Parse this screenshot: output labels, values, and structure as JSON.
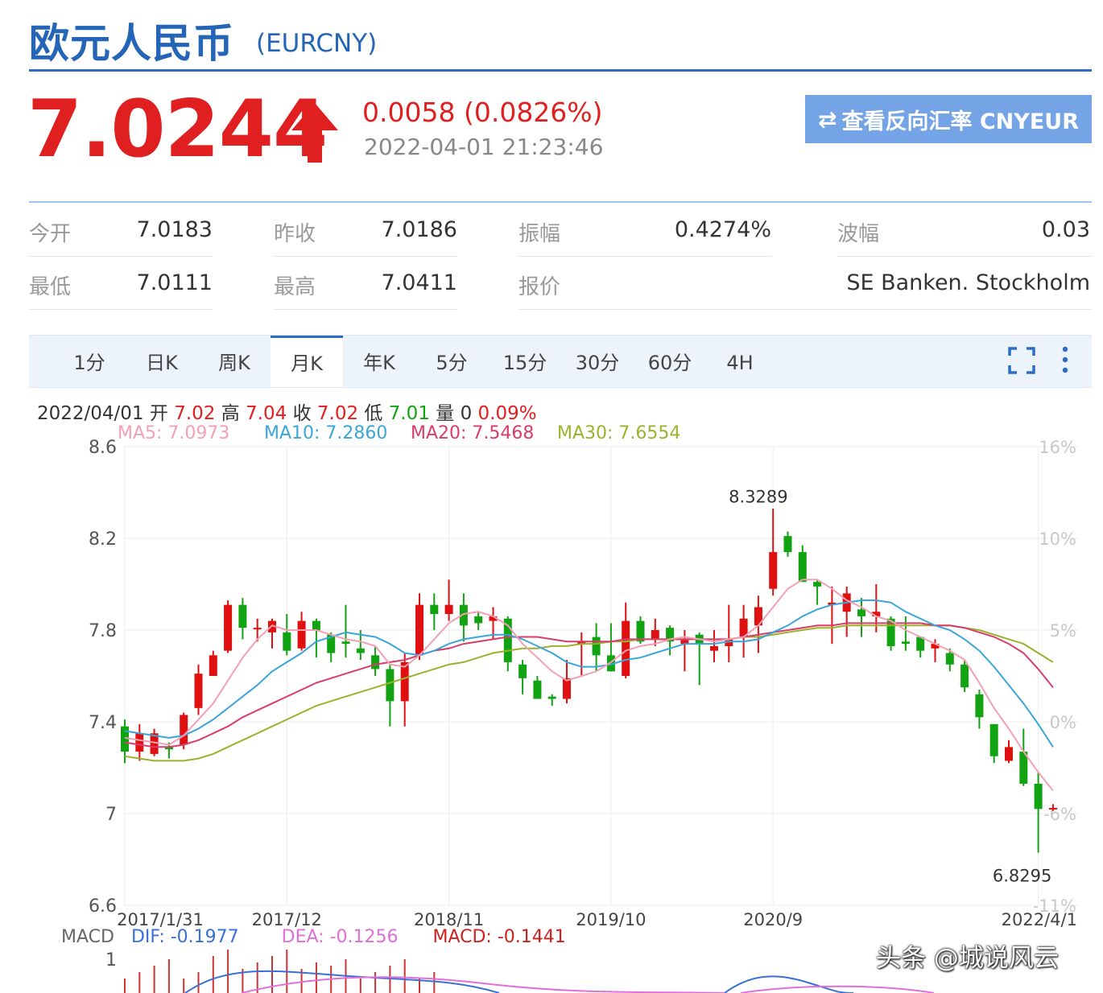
{
  "header": {
    "title": "欧元人民币",
    "code": "(EURCNY)",
    "price": "7.0244",
    "change": "0.0058 (0.0826%)",
    "time": "2022-04-01 21:23:46",
    "reverse_button": "查看反向汇率 CNYEUR",
    "price_color": "#e02020",
    "brand_color": "#2465b8"
  },
  "stats": [
    {
      "label": "今开",
      "value": "7.0183"
    },
    {
      "label": "昨收",
      "value": "7.0186"
    },
    {
      "label": "振幅",
      "value": "0.4274%"
    },
    {
      "label": "波幅",
      "value": "0.03"
    },
    {
      "label": "最低",
      "value": "7.0111"
    },
    {
      "label": "最高",
      "value": "7.0411"
    },
    {
      "label": "报价",
      "value": "SE Banken. Stockholm"
    }
  ],
  "tabs": [
    "1分",
    "日K",
    "周K",
    "月K",
    "年K",
    "5分",
    "15分",
    "30分",
    "60分",
    "4H"
  ],
  "active_tab": "月K",
  "toolbar_icons": [
    "fullscreen-icon",
    "more-vertical-icon"
  ],
  "info_line": {
    "date": "2022/04/01",
    "open_label": "开",
    "open": "7.02",
    "high_label": "高",
    "high": "7.04",
    "close_label": "收",
    "close": "7.02",
    "low_label": "低",
    "low": "7.01",
    "vol_label": "量",
    "vol": "0",
    "pct": "0.09%"
  },
  "ma_legend": [
    {
      "text": "MA5: 7.0973",
      "color": "#f2a0b4"
    },
    {
      "text": "MA10: 7.2860",
      "color": "#3aa6d8"
    },
    {
      "text": "MA20: 7.5468",
      "color": "#d83c6a"
    },
    {
      "text": "MA30: 7.6554",
      "color": "#9cb22c"
    }
  ],
  "macd_legend": {
    "label": "MACD",
    "dif": "DIF: -0.1977",
    "dea": "DEA: -0.1256",
    "macd": "MACD: -0.1441"
  },
  "watermark": "头条 @城说风云",
  "chart_data": {
    "type": "candlestick",
    "interval": "monthly",
    "ylim": [
      6.6,
      8.6
    ],
    "y_ticks": [
      "8.6",
      "8.2",
      "7.8",
      "7.4",
      "7",
      "6.6"
    ],
    "y_tick_values": [
      8.6,
      8.2,
      7.8,
      7.4,
      7.0,
      6.6
    ],
    "right_ticks": [
      "16%",
      "10%",
      "5%",
      "0%",
      "-6%",
      "-11%"
    ],
    "x_ticks": [
      "2017/1/31",
      "2017/12",
      "2018/11",
      "2019/10",
      "2020/9",
      "2022/4/1"
    ],
    "x_tick_index": [
      0,
      11,
      22,
      33,
      44,
      62
    ],
    "annotations": [
      {
        "text": "8.3289",
        "index": 43,
        "value": 8.3289
      },
      {
        "text": "6.8295",
        "index": 62,
        "value": 6.8295
      }
    ],
    "up_color": "#e01010",
    "down_color": "#12a312",
    "candles": [
      [
        7.38,
        7.27,
        7.41,
        7.22
      ],
      [
        7.27,
        7.35,
        7.39,
        7.23
      ],
      [
        7.26,
        7.35,
        7.37,
        7.25
      ],
      [
        7.29,
        7.28,
        7.31,
        7.24
      ],
      [
        7.3,
        7.43,
        7.44,
        7.28
      ],
      [
        7.46,
        7.61,
        7.65,
        7.43
      ],
      [
        7.6,
        7.69,
        7.71,
        7.6
      ],
      [
        7.71,
        7.91,
        7.93,
        7.7
      ],
      [
        7.91,
        7.81,
        7.94,
        7.76
      ],
      [
        7.81,
        7.81,
        7.85,
        7.75
      ],
      [
        7.79,
        7.84,
        7.85,
        7.72
      ],
      [
        7.79,
        7.71,
        7.87,
        7.69
      ],
      [
        7.72,
        7.84,
        7.88,
        7.71
      ],
      [
        7.84,
        7.8,
        7.85,
        7.68
      ],
      [
        7.78,
        7.7,
        7.79,
        7.66
      ],
      [
        7.75,
        7.74,
        7.91,
        7.68
      ],
      [
        7.72,
        7.7,
        7.8,
        7.67
      ],
      [
        7.69,
        7.63,
        7.73,
        7.6
      ],
      [
        7.63,
        7.49,
        7.65,
        7.38
      ],
      [
        7.49,
        7.66,
        7.7,
        7.38
      ],
      [
        7.69,
        7.91,
        7.96,
        7.67
      ],
      [
        7.91,
        7.87,
        7.96,
        7.8
      ],
      [
        7.87,
        7.91,
        8.02,
        7.84
      ],
      [
        7.91,
        7.82,
        7.96,
        7.75
      ],
      [
        7.86,
        7.83,
        7.88,
        7.8
      ],
      [
        7.84,
        7.86,
        7.9,
        7.76
      ],
      [
        7.85,
        7.66,
        7.86,
        7.62
      ],
      [
        7.65,
        7.59,
        7.67,
        7.52
      ],
      [
        7.58,
        7.5,
        7.6,
        7.5
      ],
      [
        7.51,
        7.5,
        7.52,
        7.47
      ],
      [
        7.5,
        7.59,
        7.67,
        7.48
      ],
      [
        7.74,
        7.75,
        7.79,
        7.6
      ],
      [
        7.77,
        7.69,
        7.83,
        7.62
      ],
      [
        7.69,
        7.62,
        7.83,
        7.62
      ],
      [
        7.6,
        7.84,
        7.92,
        7.59
      ],
      [
        7.84,
        7.75,
        7.86,
        7.74
      ],
      [
        7.76,
        7.8,
        7.85,
        7.73
      ],
      [
        7.81,
        7.75,
        7.82,
        7.69
      ],
      [
        7.74,
        7.76,
        7.8,
        7.62
      ],
      [
        7.78,
        7.74,
        7.79,
        7.56
      ],
      [
        7.71,
        7.73,
        7.8,
        7.66
      ],
      [
        7.73,
        7.76,
        7.91,
        7.66
      ],
      [
        7.77,
        7.85,
        7.91,
        7.68
      ],
      [
        7.82,
        7.9,
        7.95,
        7.7
      ],
      [
        7.98,
        8.14,
        8.33,
        7.95
      ],
      [
        8.21,
        8.14,
        8.23,
        8.12
      ],
      [
        8.14,
        8.01,
        8.17,
        8.01
      ],
      [
        8.01,
        7.99,
        8.02,
        7.91
      ],
      [
        7.91,
        7.92,
        7.99,
        7.74
      ],
      [
        7.88,
        7.96,
        7.99,
        7.77
      ],
      [
        7.89,
        7.86,
        7.94,
        7.77
      ],
      [
        7.86,
        7.88,
        8.0,
        7.79
      ],
      [
        7.85,
        7.73,
        7.86,
        7.71
      ],
      [
        7.75,
        7.74,
        7.86,
        7.71
      ],
      [
        7.77,
        7.71,
        7.77,
        7.68
      ],
      [
        7.72,
        7.74,
        7.76,
        7.66
      ],
      [
        7.7,
        7.65,
        7.72,
        7.62
      ],
      [
        7.65,
        7.55,
        7.67,
        7.53
      ],
      [
        7.52,
        7.42,
        7.54,
        7.37
      ],
      [
        7.39,
        7.25,
        7.39,
        7.22
      ],
      [
        7.23,
        7.29,
        7.32,
        7.22
      ],
      [
        7.27,
        7.13,
        7.37,
        7.12
      ],
      [
        7.13,
        7.02,
        7.18,
        6.83
      ],
      [
        7.0183,
        7.0244,
        7.0411,
        7.0111
      ]
    ],
    "ma5": [
      7.33,
      7.32,
      7.31,
      7.3,
      7.34,
      7.41,
      7.48,
      7.58,
      7.68,
      7.76,
      7.82,
      7.8,
      7.8,
      7.8,
      7.78,
      7.76,
      7.75,
      7.73,
      7.65,
      7.64,
      7.69,
      7.76,
      7.83,
      7.87,
      7.88,
      7.86,
      7.82,
      7.74,
      7.68,
      7.62,
      7.58,
      7.6,
      7.62,
      7.66,
      7.71,
      7.73,
      7.74,
      7.76,
      7.77,
      7.76,
      7.75,
      7.76,
      7.77,
      7.82,
      7.9,
      7.98,
      8.02,
      8.02,
      7.98,
      7.93,
      7.9,
      7.86,
      7.84,
      7.8,
      7.77,
      7.74,
      7.71,
      7.67,
      7.57,
      7.46,
      7.37,
      7.27,
      7.18,
      7.1
    ],
    "ma10": [
      7.36,
      7.35,
      7.34,
      7.33,
      7.34,
      7.37,
      7.41,
      7.46,
      7.51,
      7.56,
      7.62,
      7.66,
      7.7,
      7.75,
      7.77,
      7.79,
      7.78,
      7.77,
      7.74,
      7.7,
      7.69,
      7.71,
      7.74,
      7.76,
      7.77,
      7.78,
      7.78,
      7.76,
      7.73,
      7.7,
      7.66,
      7.64,
      7.64,
      7.65,
      7.67,
      7.68,
      7.7,
      7.72,
      7.74,
      7.74,
      7.74,
      7.75,
      7.75,
      7.76,
      7.79,
      7.82,
      7.86,
      7.89,
      7.91,
      7.92,
      7.93,
      7.93,
      7.92,
      7.88,
      7.85,
      7.82,
      7.8,
      7.76,
      7.71,
      7.64,
      7.56,
      7.48,
      7.39,
      7.29
    ],
    "ma20": [
      7.31,
      7.3,
      7.29,
      7.29,
      7.3,
      7.32,
      7.35,
      7.38,
      7.42,
      7.45,
      7.48,
      7.51,
      7.54,
      7.57,
      7.59,
      7.61,
      7.63,
      7.65,
      7.66,
      7.67,
      7.69,
      7.71,
      7.72,
      7.74,
      7.75,
      7.76,
      7.77,
      7.77,
      7.77,
      7.76,
      7.75,
      7.75,
      7.75,
      7.75,
      7.76,
      7.76,
      7.76,
      7.76,
      7.76,
      7.76,
      7.76,
      7.76,
      7.77,
      7.78,
      7.79,
      7.8,
      7.81,
      7.82,
      7.82,
      7.83,
      7.83,
      7.83,
      7.83,
      7.83,
      7.83,
      7.82,
      7.82,
      7.81,
      7.79,
      7.77,
      7.74,
      7.7,
      7.63,
      7.55
    ],
    "ma30": [
      7.25,
      7.24,
      7.23,
      7.23,
      7.23,
      7.24,
      7.26,
      7.29,
      7.32,
      7.35,
      7.38,
      7.41,
      7.44,
      7.47,
      7.49,
      7.51,
      7.53,
      7.55,
      7.57,
      7.59,
      7.61,
      7.63,
      7.65,
      7.66,
      7.68,
      7.7,
      7.71,
      7.72,
      7.72,
      7.73,
      7.73,
      7.74,
      7.74,
      7.75,
      7.75,
      7.76,
      7.76,
      7.76,
      7.76,
      7.76,
      7.76,
      7.76,
      7.77,
      7.77,
      7.78,
      7.79,
      7.8,
      7.81,
      7.81,
      7.82,
      7.82,
      7.82,
      7.82,
      7.82,
      7.82,
      7.82,
      7.82,
      7.81,
      7.8,
      7.78,
      7.76,
      7.74,
      7.7,
      7.66
    ],
    "macd_ylim": [
      -0.4,
      1
    ],
    "macd_y_ticks": [
      "1"
    ]
  }
}
